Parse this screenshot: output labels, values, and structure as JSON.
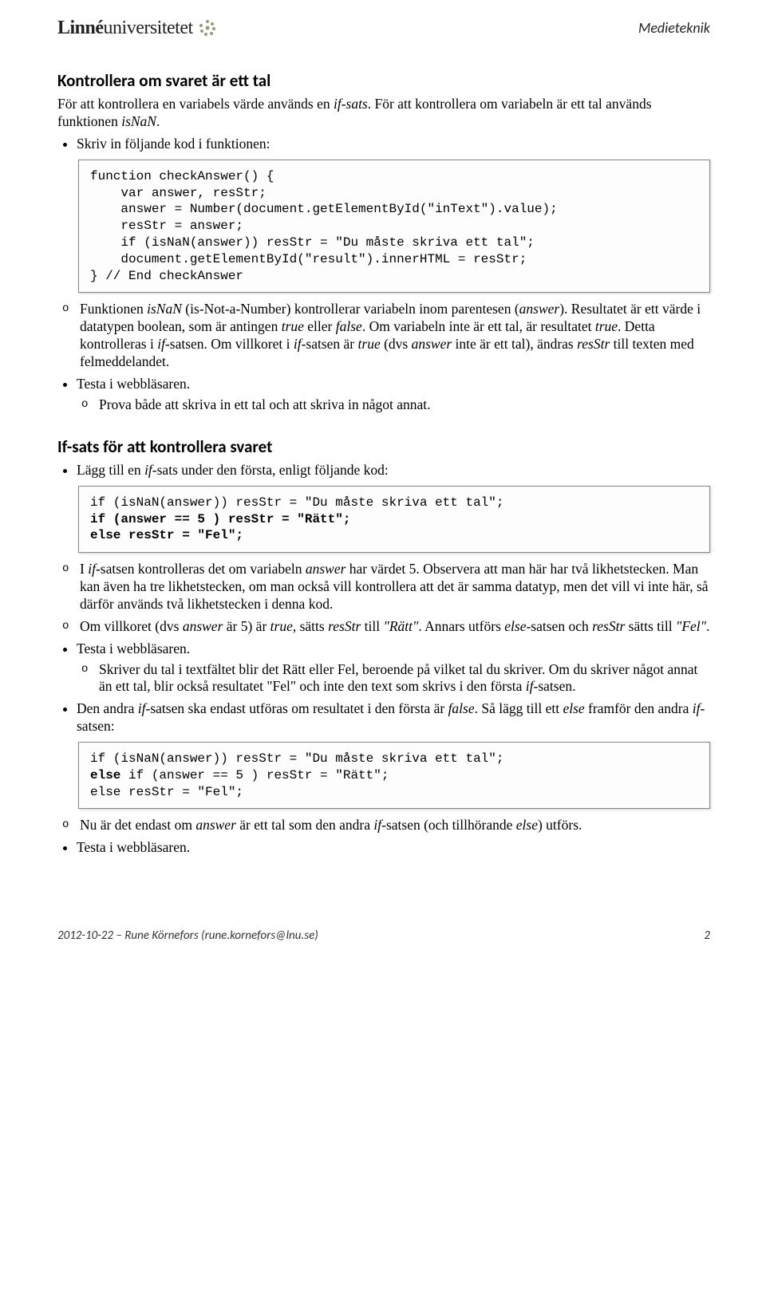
{
  "header": {
    "logo_prefix": "Linné",
    "logo_suffix": "universitetet",
    "right": "Medieteknik"
  },
  "s1": {
    "title": "Kontrollera om svaret är ett tal",
    "intro_html": "För att kontrollera en variabels värde används en <i>if-sats</i>. För att kontrollera om variabeln är ett tal används funktionen <i>isNaN</i>.",
    "b1": "Skriv in följande kod i funktionen:",
    "code1": "function checkAnswer() {\n    var answer, resStr;\n    answer = Number(document.getElementById(\"inText\").value);\n    resStr = answer;\n    if (isNaN(answer)) resStr = \"Du måste skriva ett tal\";\n    document.getElementById(\"result\").innerHTML = resStr;\n} // End checkAnswer",
    "o1_html": "Funktionen <i>isNaN</i> (is-Not-a-Number) kontrollerar variabeln inom parentesen (<i>answer</i>). Resultatet är ett värde i datatypen boolean, som är antingen <i>true</i> eller <i>false</i>. Om variabeln inte är ett tal, är resultatet <i>true</i>. Detta kontrolleras i <i>if</i>-satsen. Om villkoret i <i>if</i>-satsen är <i>true</i> (dvs <i>answer</i> inte är ett tal), ändras <i>resStr</i> till texten med felmeddelandet.",
    "b2": "Testa i webbläsaren.",
    "o2": "Prova både att skriva in ett tal och att skriva in något annat."
  },
  "s2": {
    "title": "If-sats för att kontrollera svaret",
    "b1_html": "Lägg till en <i>if</i>-sats under den första, enligt följande kod:",
    "code1": "if (isNaN(answer)) resStr = \"Du måste skriva ett tal\";\nif (answer == 5 ) resStr = \"Rätt\";\nelse resStr = \"Fel\";",
    "o1_html": "I <i>if</i>-satsen kontrolleras det om variabeln <i>answer</i> har värdet 5. Observera att man här har två likhetstecken. Man kan även ha tre likhetstecken, om man också vill kontrollera att det är samma datatyp, men det vill vi inte här, så därför används två likhetstecken i denna kod.",
    "o2_html": "Om villkoret (dvs <i>answer</i> är 5) är <i>true</i>, sätts <i>resStr</i> till <i>\"Rätt\"</i>. Annars utförs <i>else</i>-satsen och <i>resStr</i> sätts till <i>\"Fel\"</i>.",
    "b2": "Testa i webbläsaren.",
    "o3_html": "Skriver du tal i textfältet blir det Rätt eller Fel, beroende på vilket tal du skriver. Om du skriver något annat än ett tal, blir också resultatet \"Fel\" och inte den text som skrivs i den första <i>if</i>-satsen.",
    "b3_html": "Den andra <i>if</i>-satsen ska endast utföras om resultatet i den första är <i>false</i>. Så lägg till ett <i>else</i> framför den andra <i>if</i>-satsen:",
    "code2": "if (isNaN(answer)) resStr = \"Du måste skriva ett tal\";\nelse if (answer == 5 ) resStr = \"Rätt\";\nelse resStr = \"Fel\";",
    "o4_html": "Nu är det endast om <i>answer</i> är ett tal som den andra <i>if</i>-satsen (och tillhörande <i>else</i>) utförs.",
    "b4": "Testa i webbläsaren."
  },
  "footer": {
    "left": "2012-10-22 – Rune Körnefors (rune.kornefors@lnu.se)",
    "right": "2"
  }
}
